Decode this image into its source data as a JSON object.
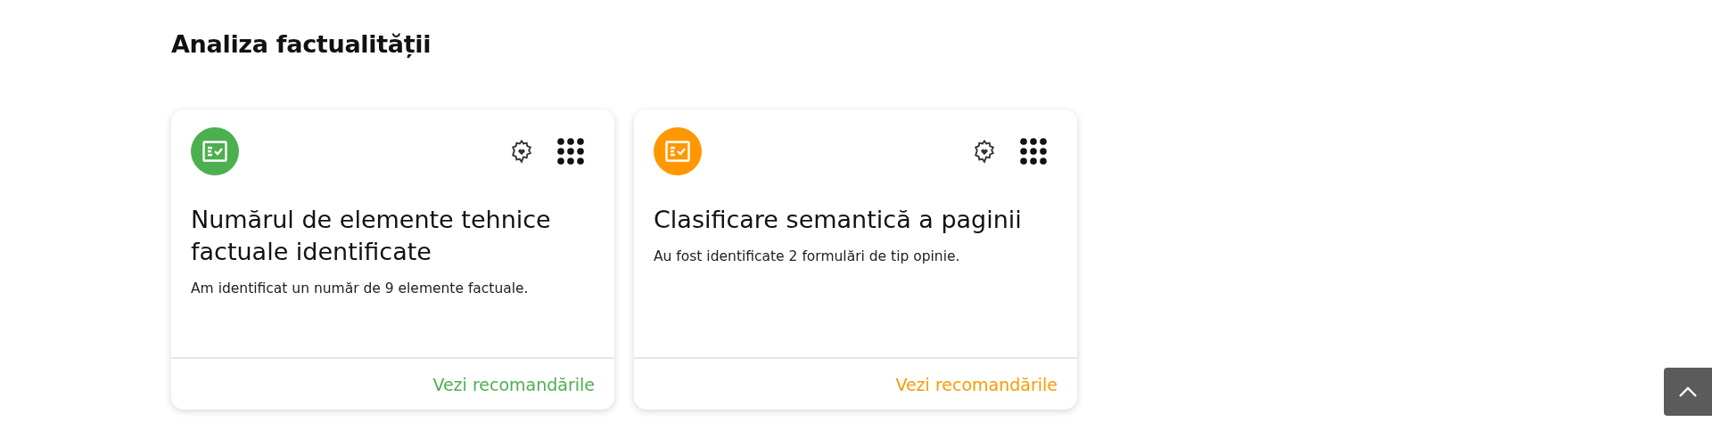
{
  "heading": "Analiza factualității",
  "cards": [
    {
      "color": "#4caf50",
      "title": "Numărul de elemente tehnice factuale identificate",
      "description": "Am identificat un număr de 9 elemente factuale.",
      "link": "Vezi recomandările"
    },
    {
      "color": "#ff9800",
      "title": "Clasificare semantică a paginii",
      "description": "Au fost identificate 2 formulări de tip opinie.",
      "link": "Vezi recomandările"
    }
  ]
}
